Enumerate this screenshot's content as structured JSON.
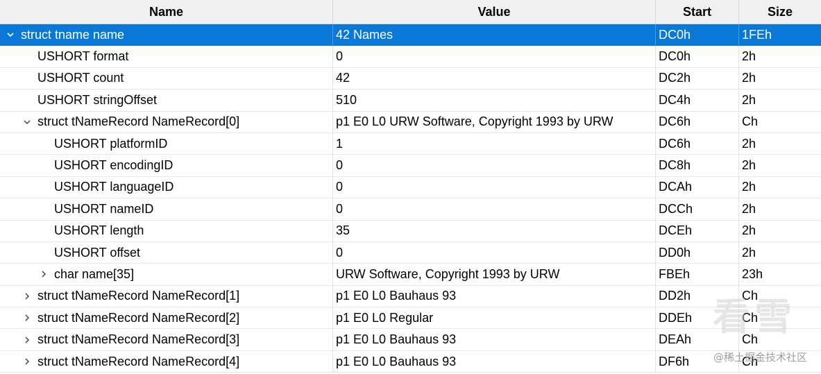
{
  "columns": {
    "name": "Name",
    "value": "Value",
    "start": "Start",
    "size": "Size"
  },
  "rows": [
    {
      "name": "struct tname name",
      "value": "42 Names",
      "start": "DC0h",
      "size": "1FEh",
      "depth": 0,
      "toggle": "expanded",
      "selected": true
    },
    {
      "name": "USHORT format",
      "value": "0",
      "start": "DC0h",
      "size": "2h",
      "depth": 1,
      "toggle": "none"
    },
    {
      "name": "USHORT count",
      "value": "42",
      "start": "DC2h",
      "size": "2h",
      "depth": 1,
      "toggle": "none"
    },
    {
      "name": "USHORT stringOffset",
      "value": "510",
      "start": "DC4h",
      "size": "2h",
      "depth": 1,
      "toggle": "none"
    },
    {
      "name": "struct tNameRecord NameRecord[0]",
      "value": "p1 E0 L0 URW Software, Copyright 1993 by URW",
      "start": "DC6h",
      "size": "Ch",
      "depth": 1,
      "toggle": "expanded"
    },
    {
      "name": "USHORT platformID",
      "value": "1",
      "start": "DC6h",
      "size": "2h",
      "depth": 2,
      "toggle": "none"
    },
    {
      "name": "USHORT encodingID",
      "value": "0",
      "start": "DC8h",
      "size": "2h",
      "depth": 2,
      "toggle": "none"
    },
    {
      "name": "USHORT languageID",
      "value": "0",
      "start": "DCAh",
      "size": "2h",
      "depth": 2,
      "toggle": "none"
    },
    {
      "name": "USHORT nameID",
      "value": "0",
      "start": "DCCh",
      "size": "2h",
      "depth": 2,
      "toggle": "none"
    },
    {
      "name": "USHORT length",
      "value": "35",
      "start": "DCEh",
      "size": "2h",
      "depth": 2,
      "toggle": "none"
    },
    {
      "name": "USHORT offset",
      "value": "0",
      "start": "DD0h",
      "size": "2h",
      "depth": 2,
      "toggle": "none"
    },
    {
      "name": "char name[35]",
      "value": "URW Software, Copyright 1993 by URW",
      "start": "FBEh",
      "size": "23h",
      "depth": 2,
      "toggle": "collapsed"
    },
    {
      "name": "struct tNameRecord NameRecord[1]",
      "value": "p1 E0 L0 Bauhaus 93",
      "start": "DD2h",
      "size": "Ch",
      "depth": 1,
      "toggle": "collapsed"
    },
    {
      "name": "struct tNameRecord NameRecord[2]",
      "value": "p1 E0 L0 Regular",
      "start": "DDEh",
      "size": "Ch",
      "depth": 1,
      "toggle": "collapsed"
    },
    {
      "name": "struct tNameRecord NameRecord[3]",
      "value": "p1 E0 L0 Bauhaus 93",
      "start": "DEAh",
      "size": "Ch",
      "depth": 1,
      "toggle": "collapsed"
    },
    {
      "name": "struct tNameRecord NameRecord[4]",
      "value": "p1 E0 L0 Bauhaus 93",
      "start": "DF6h",
      "size": "Ch",
      "depth": 1,
      "toggle": "collapsed"
    }
  ],
  "watermark": {
    "logo_text": "看雪",
    "credit": "@稀土掘金技术社区"
  }
}
